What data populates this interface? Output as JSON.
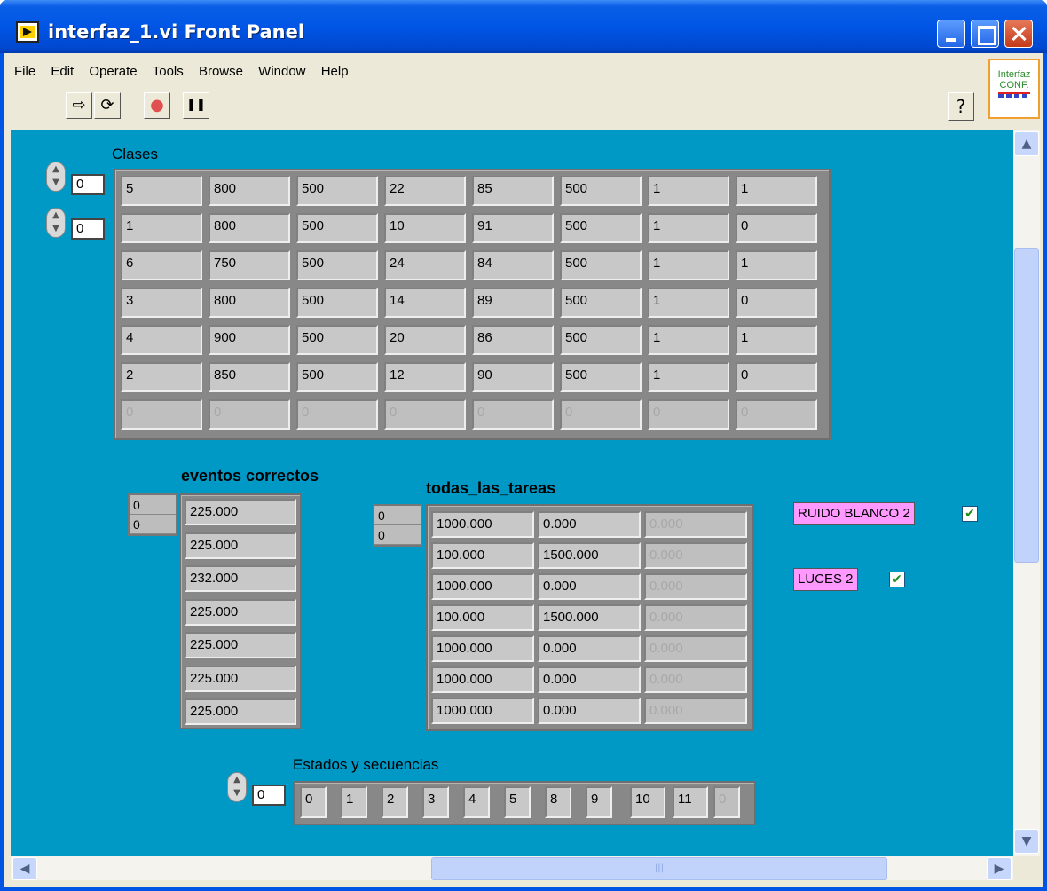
{
  "window": {
    "title": "interfaz_1.vi Front Panel"
  },
  "menu": [
    "File",
    "Edit",
    "Operate",
    "Tools",
    "Browse",
    "Window",
    "Help"
  ],
  "toolbar": {
    "run": "⇨",
    "run_continuous": "⟳",
    "abort": "●",
    "pause": "❚❚",
    "help": "?"
  },
  "conf_icon": {
    "line1": "Interfaz",
    "line2": "CONF."
  },
  "clases": {
    "label": "Clases",
    "index_row": "0",
    "index_col": "0",
    "rows": [
      [
        "5",
        "800",
        "500",
        "22",
        "85",
        "500",
        "1",
        "1"
      ],
      [
        "1",
        "800",
        "500",
        "10",
        "91",
        "500",
        "1",
        "0"
      ],
      [
        "6",
        "750",
        "500",
        "24",
        "84",
        "500",
        "1",
        "1"
      ],
      [
        "3",
        "800",
        "500",
        "14",
        "89",
        "500",
        "1",
        "0"
      ],
      [
        "4",
        "900",
        "500",
        "20",
        "86",
        "500",
        "1",
        "1"
      ],
      [
        "2",
        "850",
        "500",
        "12",
        "90",
        "500",
        "1",
        "0"
      ],
      [
        "0",
        "0",
        "0",
        "0",
        "0",
        "0",
        "0",
        "0"
      ]
    ]
  },
  "eventos": {
    "label": "eventos correctos",
    "index_a": "0",
    "index_b": "0",
    "values": [
      "225.000",
      "225.000",
      "232.000",
      "225.000",
      "225.000",
      "225.000",
      "225.000"
    ]
  },
  "tareas": {
    "label": "todas_las_tareas",
    "index_a": "0",
    "index_b": "0",
    "rows": [
      [
        "1000.000",
        "0.000",
        "0.000"
      ],
      [
        "100.000",
        "1500.000",
        "0.000"
      ],
      [
        "1000.000",
        "0.000",
        "0.000"
      ],
      [
        "100.000",
        "1500.000",
        "0.000"
      ],
      [
        "1000.000",
        "0.000",
        "0.000"
      ],
      [
        "1000.000",
        "0.000",
        "0.000"
      ],
      [
        "1000.000",
        "0.000",
        "0.000"
      ]
    ]
  },
  "toggles": [
    {
      "label": "RUIDO BLANCO 2",
      "checked": true
    },
    {
      "label": "LUCES 2",
      "checked": true
    }
  ],
  "estados": {
    "label": "Estados y secuencias",
    "index": "0",
    "values": [
      "0",
      "1",
      "2",
      "3",
      "4",
      "5",
      "8",
      "9",
      "10",
      "11",
      "0"
    ]
  }
}
